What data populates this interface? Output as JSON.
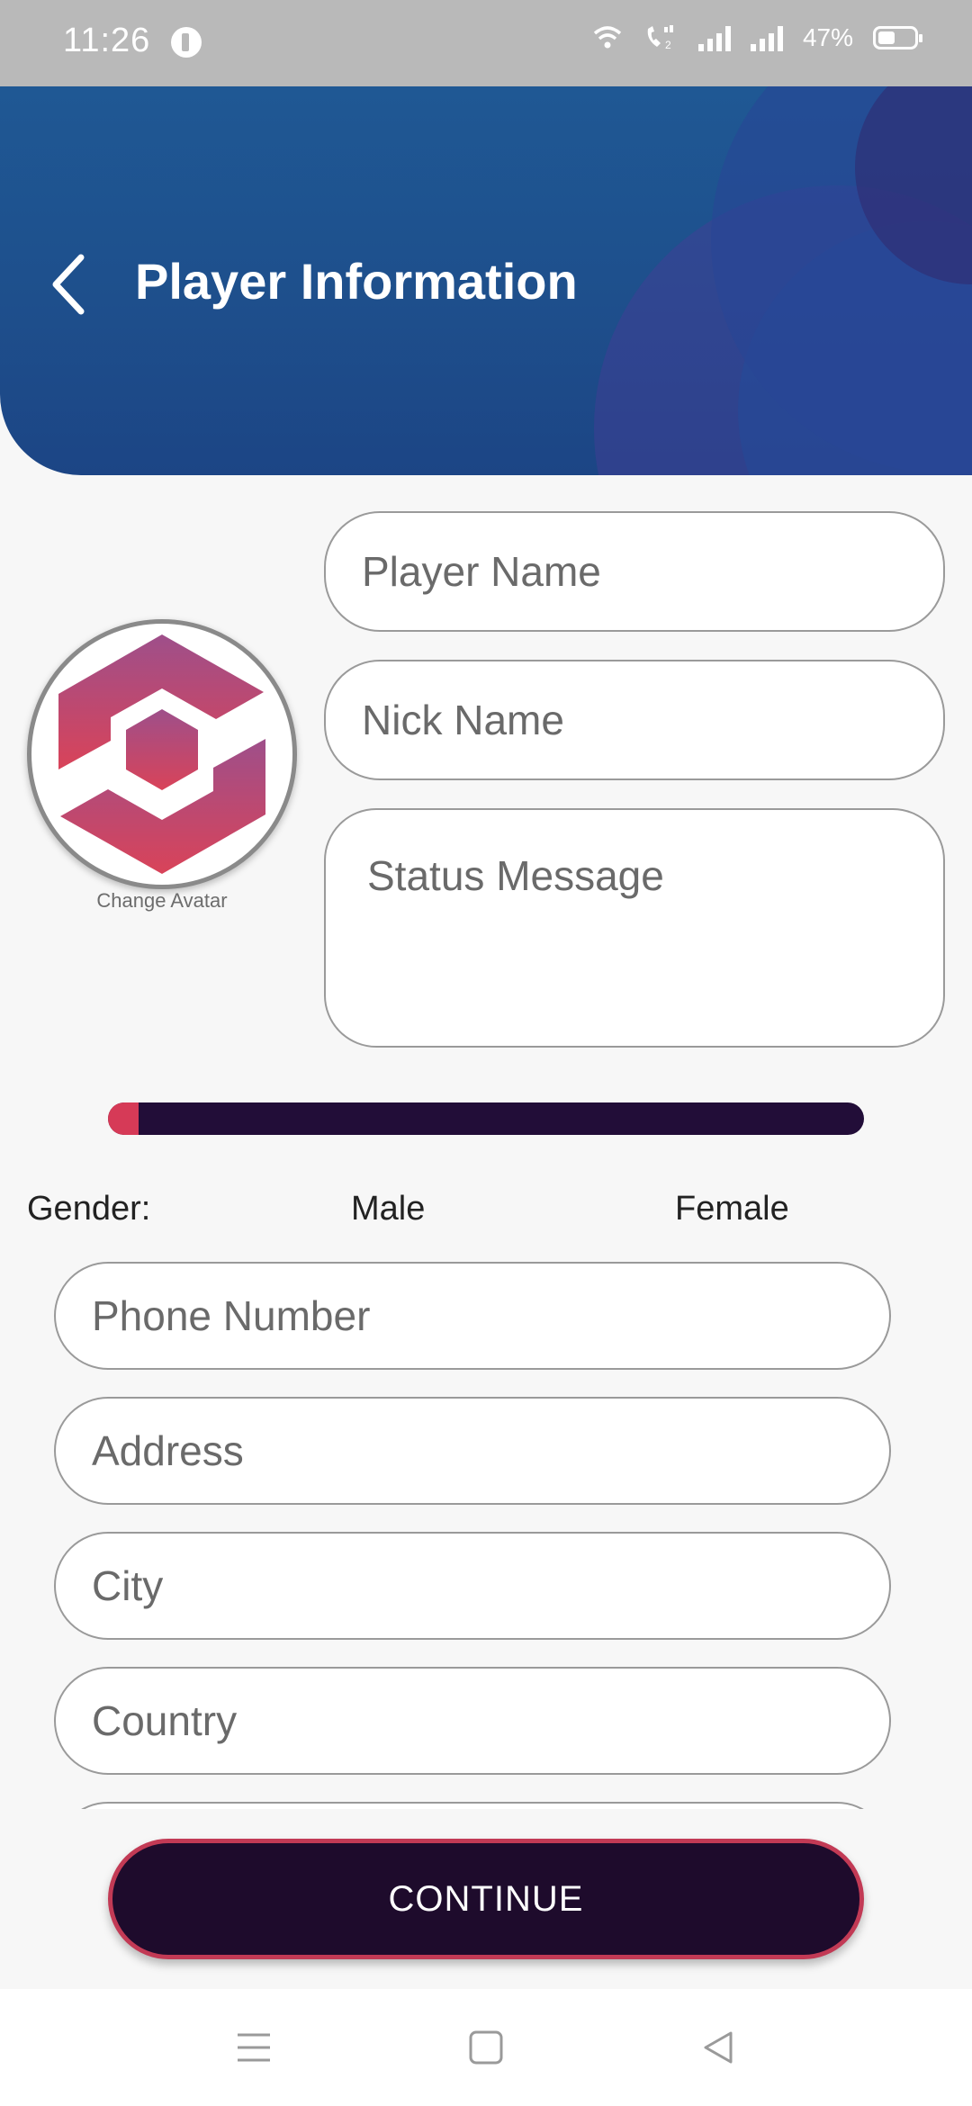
{
  "status_bar": {
    "time": "11:26",
    "battery_percent": "47%"
  },
  "header": {
    "title": "Player Information"
  },
  "form": {
    "player_name": {
      "placeholder": "Player Name",
      "value": ""
    },
    "nick_name": {
      "placeholder": "Nick Name",
      "value": ""
    },
    "status_message": {
      "placeholder": "Status Message",
      "value": ""
    },
    "avatar": {
      "change_label": "Change Avatar"
    },
    "level_slider": {
      "fraction": 0.04
    },
    "gender": {
      "label": "Gender:",
      "options": [
        "Male",
        "Female"
      ]
    },
    "phone_number": {
      "placeholder": "Phone Number",
      "value": ""
    },
    "address": {
      "placeholder": "Address",
      "value": ""
    },
    "city": {
      "placeholder": "City",
      "value": ""
    },
    "country": {
      "placeholder": "Country",
      "value": ""
    }
  },
  "continue_label": "CONTINUE",
  "colors": {
    "header_blue": "#1e4f8c",
    "slider_track": "#220d38",
    "slider_fill": "#d63a57",
    "button_bg": "#1e0b2c",
    "button_border": "#c23a55"
  },
  "icons": {
    "back": "chevron-left-icon",
    "alarm": "alarm-icon",
    "wifi": "wifi-icon",
    "call": "wifi-call-icon",
    "signal": "signal-icon",
    "battery": "battery-icon",
    "nav_menu": "menu-icon",
    "nav_home": "home-square-icon",
    "nav_back": "back-triangle-icon"
  }
}
